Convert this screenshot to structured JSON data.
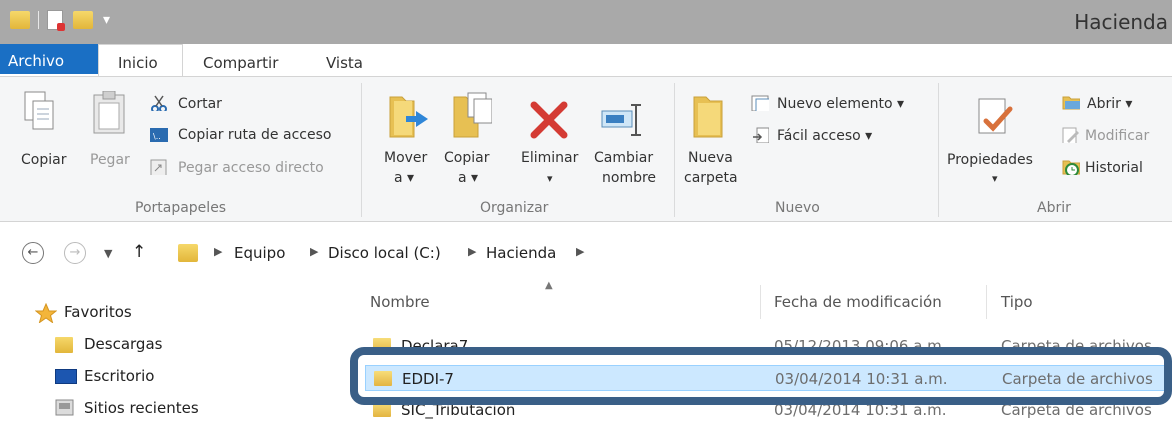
{
  "window": {
    "title": "Hacienda"
  },
  "ribbon_tabs": {
    "file": "Archivo",
    "home": "Inicio",
    "share": "Compartir",
    "view": "Vista"
  },
  "clipboard": {
    "copy": "Copiar",
    "paste": "Pegar",
    "cut": "Cortar",
    "copy_path": "Copiar ruta de acceso",
    "paste_shortcut": "Pegar acceso directo",
    "label": "Portapapeles"
  },
  "organize": {
    "move_line1": "Mover",
    "move_line2": "a ▾",
    "copy_line1": "Copiar",
    "copy_line2": "a ▾",
    "delete": "Eliminar",
    "delete_arrow": "▾",
    "rename_line1": "Cambiar",
    "rename_line2": "nombre",
    "label": "Organizar"
  },
  "new": {
    "folder_line1": "Nueva",
    "folder_line2": "carpeta",
    "new_item": "Nuevo elemento ▾",
    "easy_access": "Fácil acceso ▾",
    "label": "Nuevo"
  },
  "open": {
    "properties": "Propiedades",
    "properties_arrow": "▾",
    "open": "Abrir ▾",
    "edit": "Modificar",
    "history": "Historial",
    "label": "Abrir"
  },
  "address": {
    "crumbs": [
      "Equipo",
      "Disco local (C:)",
      "Hacienda"
    ]
  },
  "nav": {
    "favorites": "Favoritos",
    "items": [
      "Descargas",
      "Escritorio",
      "Sitios recientes"
    ]
  },
  "columns": {
    "name": "Nombre",
    "date": "Fecha de modificación",
    "type": "Tipo"
  },
  "files": [
    {
      "name": "Declara7",
      "date": "05/12/2013 09:06 a.m.",
      "type": "Carpeta de archivos"
    },
    {
      "name": "EDDI-7",
      "date": "03/04/2014 10:31 a.m.",
      "type": "Carpeta de archivos"
    },
    {
      "name": "SIC_Tributacion",
      "date": "03/04/2014 10:31 a.m.",
      "type": "Carpeta de archivos"
    }
  ],
  "colors": {
    "accent": "#1a6fc4",
    "highlight_border": "#3a5f87",
    "selection": "#cce8ff"
  }
}
